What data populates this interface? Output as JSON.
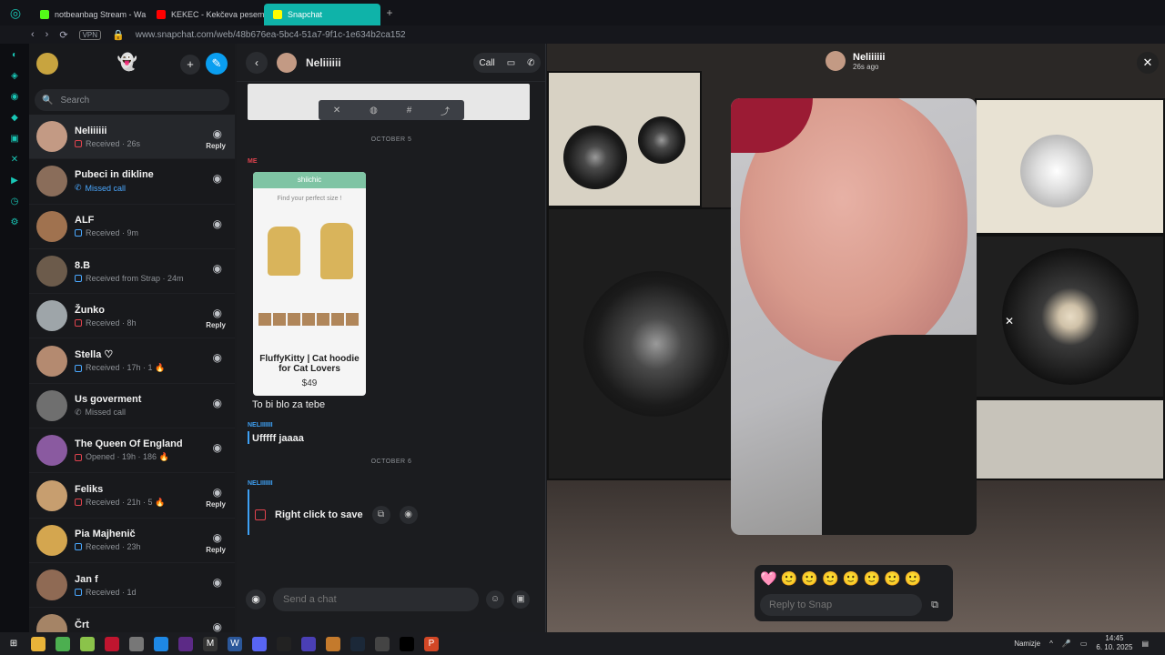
{
  "browser": {
    "tabs": [
      {
        "title": "notbeanbag Stream - Wa",
        "color": "#53fc18"
      },
      {
        "title": "KEKEC - Kekčeva pesem",
        "color": "#ff0000"
      },
      {
        "title": "Snapchat",
        "color": "#fffc00"
      }
    ],
    "new_tab": "+",
    "url": "www.snapchat.com/web/48b676ea-5bc4-51a7-9f1c-1e634b2ca152",
    "vpn": "VPN"
  },
  "chat_list": {
    "search_placeholder": "Search",
    "items": [
      {
        "name": "Neliiiiii",
        "status": "Received · 26s",
        "reply": "Reply",
        "type": "received"
      },
      {
        "name": "Pubeci in dikline",
        "status": "Missed call",
        "reply": "",
        "type": "missed"
      },
      {
        "name": "ALF",
        "status": "Received · 9m",
        "reply": "",
        "type": "received-blue"
      },
      {
        "name": "8.B",
        "status": "Received from Strap · 24m",
        "reply": "",
        "type": "received-blue"
      },
      {
        "name": "Žunko",
        "status": "Received · 8h",
        "reply": "Reply",
        "type": "received"
      },
      {
        "name": "Stella ♡",
        "status": "Received · 17h · 1 🔥",
        "reply": "",
        "type": "received-blue"
      },
      {
        "name": "Us goverment",
        "status": "Missed call",
        "reply": "",
        "type": "missed-grey"
      },
      {
        "name": "The Queen Of England",
        "status": "Opened · 19h · 186 🔥",
        "reply": "",
        "type": "opened"
      },
      {
        "name": "Feliks",
        "status": "Received · 21h · 5 🔥",
        "reply": "Reply",
        "type": "received"
      },
      {
        "name": "Pia Majhenič",
        "status": "Received · 23h",
        "reply": "Reply",
        "type": "received-blue"
      },
      {
        "name": "Jan f",
        "status": "Received · 1d",
        "reply": "",
        "type": "received-blue"
      },
      {
        "name": "Črt",
        "status": "",
        "reply": "",
        "type": "received"
      }
    ]
  },
  "conversation": {
    "name": "Neliiiiii",
    "call_label": "Call",
    "date1": "OCTOBER 5",
    "me_label": "ME",
    "product": {
      "brand": "shiichic",
      "subtitle": "Find your perfect size !",
      "title": "FluffyKitty | Cat hoodie for Cat Lovers",
      "price": "$49"
    },
    "msg_me": "To bi blo za tebe",
    "sender_label": "NELIIIIIII",
    "msg_nel": "Ufffff jaaaa",
    "date2": "OCTOBER 6",
    "sender_label2": "NELIIIIIII",
    "save_label": "Right click to save",
    "compose_placeholder": "Send a chat"
  },
  "snap": {
    "user": "Neliiiiii",
    "time": "26s ago",
    "reply_placeholder": "Reply to Snap",
    "emojis": [
      "🩷",
      "🙂",
      "🙂",
      "🙂",
      "🙂",
      "🙂",
      "🙂",
      "🙂"
    ]
  },
  "taskbar": {
    "lang": "Namizje",
    "time": "14:45",
    "date": "6. 10. 2025"
  }
}
